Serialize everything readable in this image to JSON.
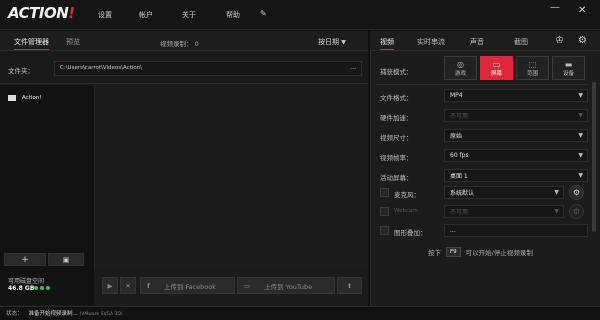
{
  "app": {
    "logo_main": "ACTION",
    "logo_bang": "!"
  },
  "menu": {
    "settings": "设置",
    "account": "帐户",
    "about": "关于",
    "help": "帮助"
  },
  "window": {
    "minimize": "—",
    "close": "✕"
  },
  "left": {
    "tabs": {
      "file_manager": "文件管理器",
      "preview": "预览"
    },
    "recording_label": "视频录制：",
    "recording_count": "0",
    "sort": "按日期",
    "folder_label": "文件夹：",
    "folder_path": "C:\\Users\\carrot\\Videos\\Action\\",
    "more": "...",
    "tree_root": "Action!",
    "disk_label": "可用磁盘空间",
    "disk_value": "46.8 GB",
    "add": "+",
    "upload_facebook": "上传到 Facebook",
    "upload_youtube": "上传到 YouTube"
  },
  "right": {
    "tabs": {
      "video": "视频",
      "live": "实时串流",
      "audio": "声音",
      "screenshot": "截图"
    },
    "capture_mode_label": "捕获模式：",
    "modes": [
      {
        "label": "游戏",
        "active": false
      },
      {
        "label": "屏幕",
        "active": true
      },
      {
        "label": "范围",
        "active": false
      },
      {
        "label": "设备",
        "active": false
      }
    ],
    "file_format_label": "文件格式：",
    "file_format": "MP4",
    "hw_accel_label": "硬件加速：",
    "hw_accel": "不可用",
    "video_size_label": "视频尺寸：",
    "video_size": "原始",
    "frame_rate_label": "视频帧率：",
    "frame_rate": "60 fps",
    "active_screen_label": "活动屏幕：",
    "active_screen": "桌面 1",
    "mic_label": "麦克风：",
    "mic": "系统默认",
    "webcam_label": "Webcam",
    "webcam": "不可用",
    "overlay_label": "图形叠加：",
    "overlay": "...",
    "hint_press": "按下",
    "hint_key": "F9",
    "hint_text": "可以开始/停止视频录制"
  },
  "status": {
    "label": "状态：",
    "text": "准备开始视频录制...",
    "gpu": "(VMware SVGA 3D)"
  },
  "colors": {
    "accent": "#e0263a",
    "bg": "#1b1b1b"
  }
}
